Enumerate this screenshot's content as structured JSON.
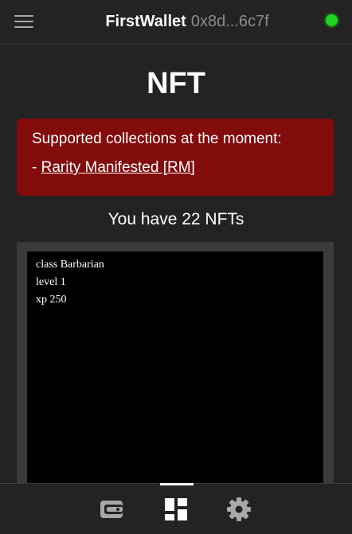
{
  "header": {
    "app_name": "FirstWallet",
    "address": "0x8d...6c7f",
    "menu_icon": "hamburger-menu-icon",
    "status_color": "#1fd31f"
  },
  "main": {
    "title": "NFT",
    "notice": {
      "text": "Supported collections at the moment:",
      "prefix": "- ",
      "link_label": "Rarity Manifested [RM]",
      "background": "#820b0b"
    },
    "nft_count_text": "You have 22 NFTs",
    "nft_card": {
      "lines": [
        "class Barbarian",
        "level 1",
        "xp 250"
      ]
    }
  },
  "bottom_nav": {
    "items": [
      {
        "icon": "wallet-icon",
        "active": false
      },
      {
        "icon": "nft-grid-icon",
        "active": true
      },
      {
        "icon": "gear-icon",
        "active": false
      }
    ]
  }
}
